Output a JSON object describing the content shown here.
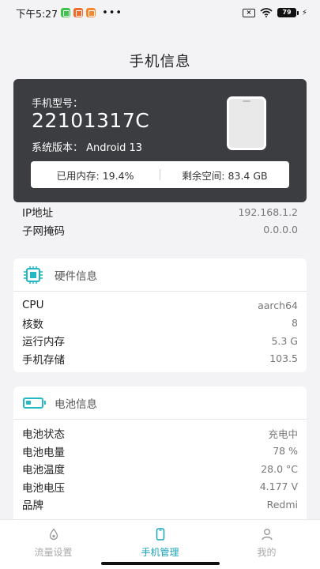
{
  "status_bar": {
    "time": "下午5:27",
    "battery": "79"
  },
  "page": {
    "title": "手机信息"
  },
  "device": {
    "model_label": "手机型号：",
    "model": "22101317C",
    "version": "系统版本： Android 13",
    "memory_used": "已用内存:   19.4%",
    "storage_free": "剩余空间:   83.4 GB"
  },
  "network": {
    "rows": [
      {
        "label": "IP地址",
        "value": "192.168.1.2"
      },
      {
        "label": "子网掩码",
        "value": "0.0.0.0"
      }
    ]
  },
  "hardware": {
    "title": "硬件信息",
    "rows": [
      {
        "label": "CPU",
        "value": "aarch64"
      },
      {
        "label": "核数",
        "value": "8"
      },
      {
        "label": "运行内存",
        "value": "5.3 G"
      },
      {
        "label": "手机存储",
        "value": "103.5"
      }
    ]
  },
  "battery": {
    "title": "电池信息",
    "rows": [
      {
        "label": "电池状态",
        "value": "充电中"
      },
      {
        "label": "电池电量",
        "value": "78 %"
      },
      {
        "label": "电池温度",
        "value": "28.0 °C"
      },
      {
        "label": "电池电压",
        "value": "4.177 V"
      },
      {
        "label": "品牌",
        "value": "Redmi"
      }
    ]
  },
  "tabs": [
    {
      "label": "流量设置",
      "icon": "drop-icon",
      "active": false
    },
    {
      "label": "手机管理",
      "icon": "phone-icon",
      "active": true
    },
    {
      "label": "我的",
      "icon": "person-icon",
      "active": false
    }
  ],
  "colors": {
    "accent": "#1aa5b7",
    "hero_bg": "#3c3d40",
    "page_bg": "#f3f3f5"
  }
}
